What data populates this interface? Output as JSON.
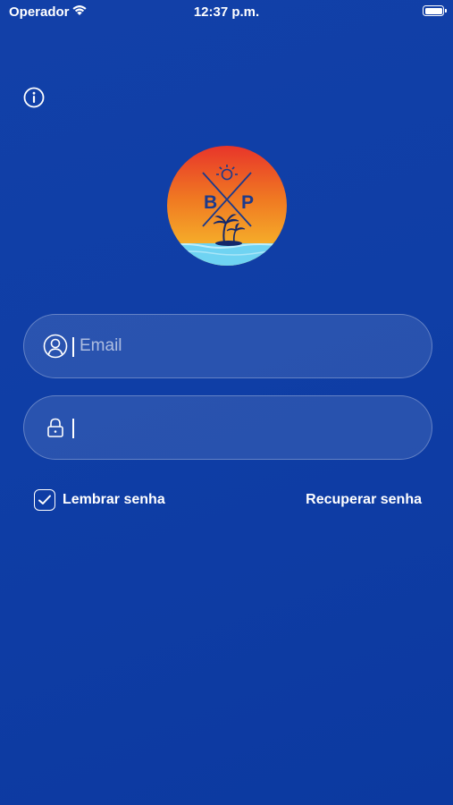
{
  "status_bar": {
    "carrier": "Operador",
    "time": "12:37 p.m."
  },
  "header": {
    "info_icon": "info-circle-icon"
  },
  "logo": {
    "letters": [
      "B",
      "P"
    ],
    "icons": [
      "sun-icon",
      "palm-trees-icon"
    ],
    "colors": {
      "top": "#e8352a",
      "middle": "#f5a623",
      "sea": "#6fd3f2"
    }
  },
  "login_form": {
    "email": {
      "placeholder": "Email",
      "value": "",
      "icon": "user-circle-icon"
    },
    "password": {
      "placeholder": "",
      "value": "",
      "icon": "lock-icon"
    },
    "remember": {
      "label": "Lembrar senha",
      "checked": true
    },
    "recover_label": "Recuperar senha"
  },
  "colors": {
    "background": "#0f3ea6",
    "field_fill": "rgba(255,255,255,0.11)",
    "text": "#ffffff"
  }
}
